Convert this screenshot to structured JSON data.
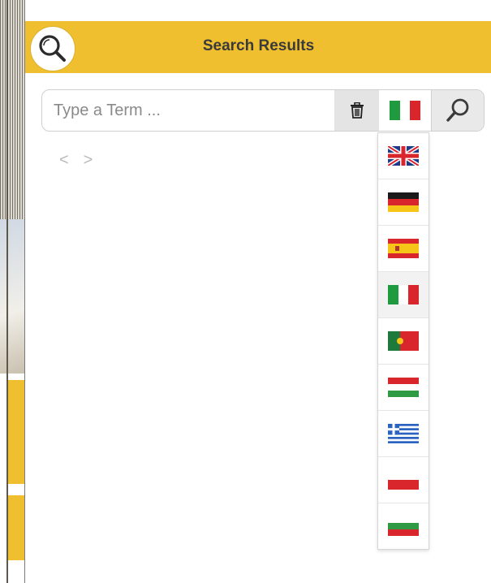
{
  "header": {
    "title": "Search Results",
    "icon": "search-icon",
    "bg_color": "#f0bf2f"
  },
  "search": {
    "placeholder": "Type a Term ...",
    "value": "",
    "clear_icon": "trash-icon",
    "submit_icon": "search-icon",
    "selected_language": "it"
  },
  "pager": {
    "prev": "<",
    "next": ">"
  },
  "languages": [
    {
      "code": "en",
      "icon": "uk-flag-icon"
    },
    {
      "code": "de",
      "icon": "germany-flag-icon"
    },
    {
      "code": "es",
      "icon": "spain-flag-icon"
    },
    {
      "code": "it",
      "icon": "italy-flag-icon",
      "selected": true
    },
    {
      "code": "pt",
      "icon": "portugal-flag-icon"
    },
    {
      "code": "hu",
      "icon": "hungary-flag-icon"
    },
    {
      "code": "el",
      "icon": "greece-flag-icon"
    },
    {
      "code": "pl",
      "icon": "poland-flag-icon"
    },
    {
      "code": "bg",
      "icon": "bulgaria-flag-icon"
    }
  ]
}
